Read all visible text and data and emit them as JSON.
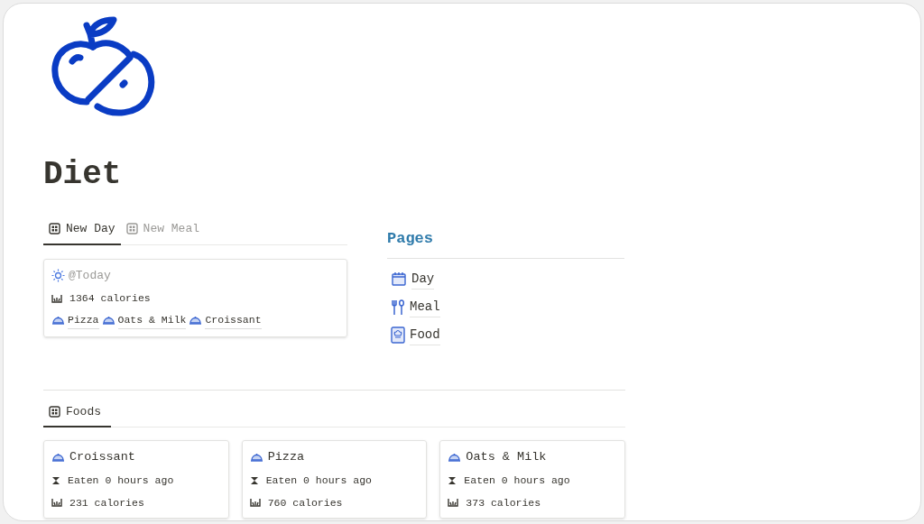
{
  "title": "Diet",
  "views": [
    {
      "label": "New Day",
      "selected": true
    },
    {
      "label": "New Meal",
      "selected": false
    }
  ],
  "day_card": {
    "date": "@Today",
    "calories": "1364 calories",
    "foods": [
      "Pizza",
      "Oats & Milk",
      "Croissant"
    ]
  },
  "pages": {
    "heading": "Pages",
    "items": [
      {
        "label": "Day",
        "kind": "calendar"
      },
      {
        "label": "Meal",
        "kind": "cutlery"
      },
      {
        "label": "Food",
        "kind": "book"
      }
    ]
  },
  "foods_views": [
    {
      "label": "Foods",
      "selected": true
    }
  ],
  "food_cards": [
    {
      "name": "Croissant",
      "eaten": "Eaten 0 hours ago",
      "calories": "231 calories"
    },
    {
      "name": "Pizza",
      "eaten": "Eaten 0 hours ago",
      "calories": "760 calories"
    },
    {
      "name": "Oats & Milk",
      "eaten": "Eaten 0 hours ago",
      "calories": "373 calories"
    }
  ]
}
